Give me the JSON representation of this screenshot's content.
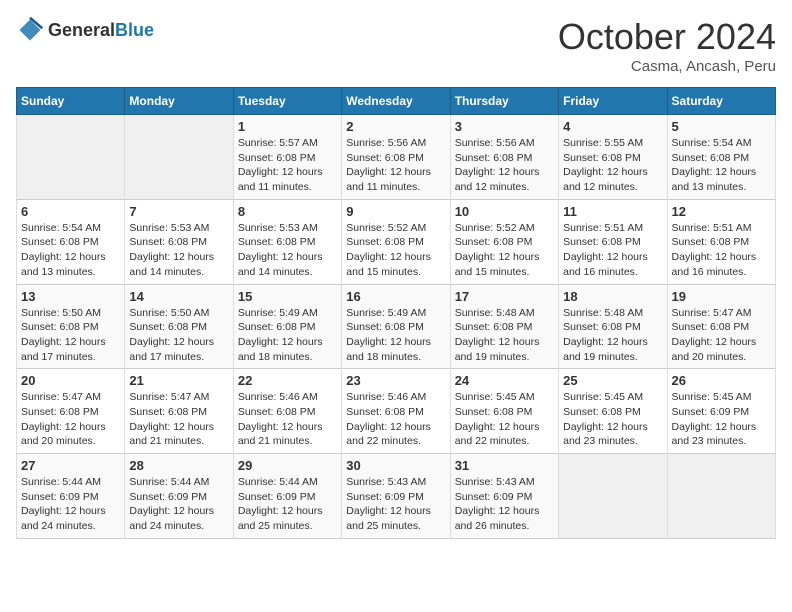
{
  "header": {
    "logo_general": "General",
    "logo_blue": "Blue",
    "month": "October 2024",
    "location": "Casma, Ancash, Peru"
  },
  "columns": [
    "Sunday",
    "Monday",
    "Tuesday",
    "Wednesday",
    "Thursday",
    "Friday",
    "Saturday"
  ],
  "weeks": [
    [
      {
        "day": "",
        "empty": true
      },
      {
        "day": "",
        "empty": true
      },
      {
        "day": "1",
        "sunrise": "5:57 AM",
        "sunset": "6:08 PM",
        "daylight": "12 hours and 11 minutes."
      },
      {
        "day": "2",
        "sunrise": "5:56 AM",
        "sunset": "6:08 PM",
        "daylight": "12 hours and 11 minutes."
      },
      {
        "day": "3",
        "sunrise": "5:56 AM",
        "sunset": "6:08 PM",
        "daylight": "12 hours and 12 minutes."
      },
      {
        "day": "4",
        "sunrise": "5:55 AM",
        "sunset": "6:08 PM",
        "daylight": "12 hours and 12 minutes."
      },
      {
        "day": "5",
        "sunrise": "5:54 AM",
        "sunset": "6:08 PM",
        "daylight": "12 hours and 13 minutes."
      }
    ],
    [
      {
        "day": "6",
        "sunrise": "5:54 AM",
        "sunset": "6:08 PM",
        "daylight": "12 hours and 13 minutes."
      },
      {
        "day": "7",
        "sunrise": "5:53 AM",
        "sunset": "6:08 PM",
        "daylight": "12 hours and 14 minutes."
      },
      {
        "day": "8",
        "sunrise": "5:53 AM",
        "sunset": "6:08 PM",
        "daylight": "12 hours and 14 minutes."
      },
      {
        "day": "9",
        "sunrise": "5:52 AM",
        "sunset": "6:08 PM",
        "daylight": "12 hours and 15 minutes."
      },
      {
        "day": "10",
        "sunrise": "5:52 AM",
        "sunset": "6:08 PM",
        "daylight": "12 hours and 15 minutes."
      },
      {
        "day": "11",
        "sunrise": "5:51 AM",
        "sunset": "6:08 PM",
        "daylight": "12 hours and 16 minutes."
      },
      {
        "day": "12",
        "sunrise": "5:51 AM",
        "sunset": "6:08 PM",
        "daylight": "12 hours and 16 minutes."
      }
    ],
    [
      {
        "day": "13",
        "sunrise": "5:50 AM",
        "sunset": "6:08 PM",
        "daylight": "12 hours and 17 minutes."
      },
      {
        "day": "14",
        "sunrise": "5:50 AM",
        "sunset": "6:08 PM",
        "daylight": "12 hours and 17 minutes."
      },
      {
        "day": "15",
        "sunrise": "5:49 AM",
        "sunset": "6:08 PM",
        "daylight": "12 hours and 18 minutes."
      },
      {
        "day": "16",
        "sunrise": "5:49 AM",
        "sunset": "6:08 PM",
        "daylight": "12 hours and 18 minutes."
      },
      {
        "day": "17",
        "sunrise": "5:48 AM",
        "sunset": "6:08 PM",
        "daylight": "12 hours and 19 minutes."
      },
      {
        "day": "18",
        "sunrise": "5:48 AM",
        "sunset": "6:08 PM",
        "daylight": "12 hours and 19 minutes."
      },
      {
        "day": "19",
        "sunrise": "5:47 AM",
        "sunset": "6:08 PM",
        "daylight": "12 hours and 20 minutes."
      }
    ],
    [
      {
        "day": "20",
        "sunrise": "5:47 AM",
        "sunset": "6:08 PM",
        "daylight": "12 hours and 20 minutes."
      },
      {
        "day": "21",
        "sunrise": "5:47 AM",
        "sunset": "6:08 PM",
        "daylight": "12 hours and 21 minutes."
      },
      {
        "day": "22",
        "sunrise": "5:46 AM",
        "sunset": "6:08 PM",
        "daylight": "12 hours and 21 minutes."
      },
      {
        "day": "23",
        "sunrise": "5:46 AM",
        "sunset": "6:08 PM",
        "daylight": "12 hours and 22 minutes."
      },
      {
        "day": "24",
        "sunrise": "5:45 AM",
        "sunset": "6:08 PM",
        "daylight": "12 hours and 22 minutes."
      },
      {
        "day": "25",
        "sunrise": "5:45 AM",
        "sunset": "6:08 PM",
        "daylight": "12 hours and 23 minutes."
      },
      {
        "day": "26",
        "sunrise": "5:45 AM",
        "sunset": "6:09 PM",
        "daylight": "12 hours and 23 minutes."
      }
    ],
    [
      {
        "day": "27",
        "sunrise": "5:44 AM",
        "sunset": "6:09 PM",
        "daylight": "12 hours and 24 minutes."
      },
      {
        "day": "28",
        "sunrise": "5:44 AM",
        "sunset": "6:09 PM",
        "daylight": "12 hours and 24 minutes."
      },
      {
        "day": "29",
        "sunrise": "5:44 AM",
        "sunset": "6:09 PM",
        "daylight": "12 hours and 25 minutes."
      },
      {
        "day": "30",
        "sunrise": "5:43 AM",
        "sunset": "6:09 PM",
        "daylight": "12 hours and 25 minutes."
      },
      {
        "day": "31",
        "sunrise": "5:43 AM",
        "sunset": "6:09 PM",
        "daylight": "12 hours and 26 minutes."
      },
      {
        "day": "",
        "empty": true
      },
      {
        "day": "",
        "empty": true
      }
    ]
  ],
  "daylight_label": "Daylight:",
  "sunrise_label": "Sunrise:",
  "sunset_label": "Sunset:"
}
